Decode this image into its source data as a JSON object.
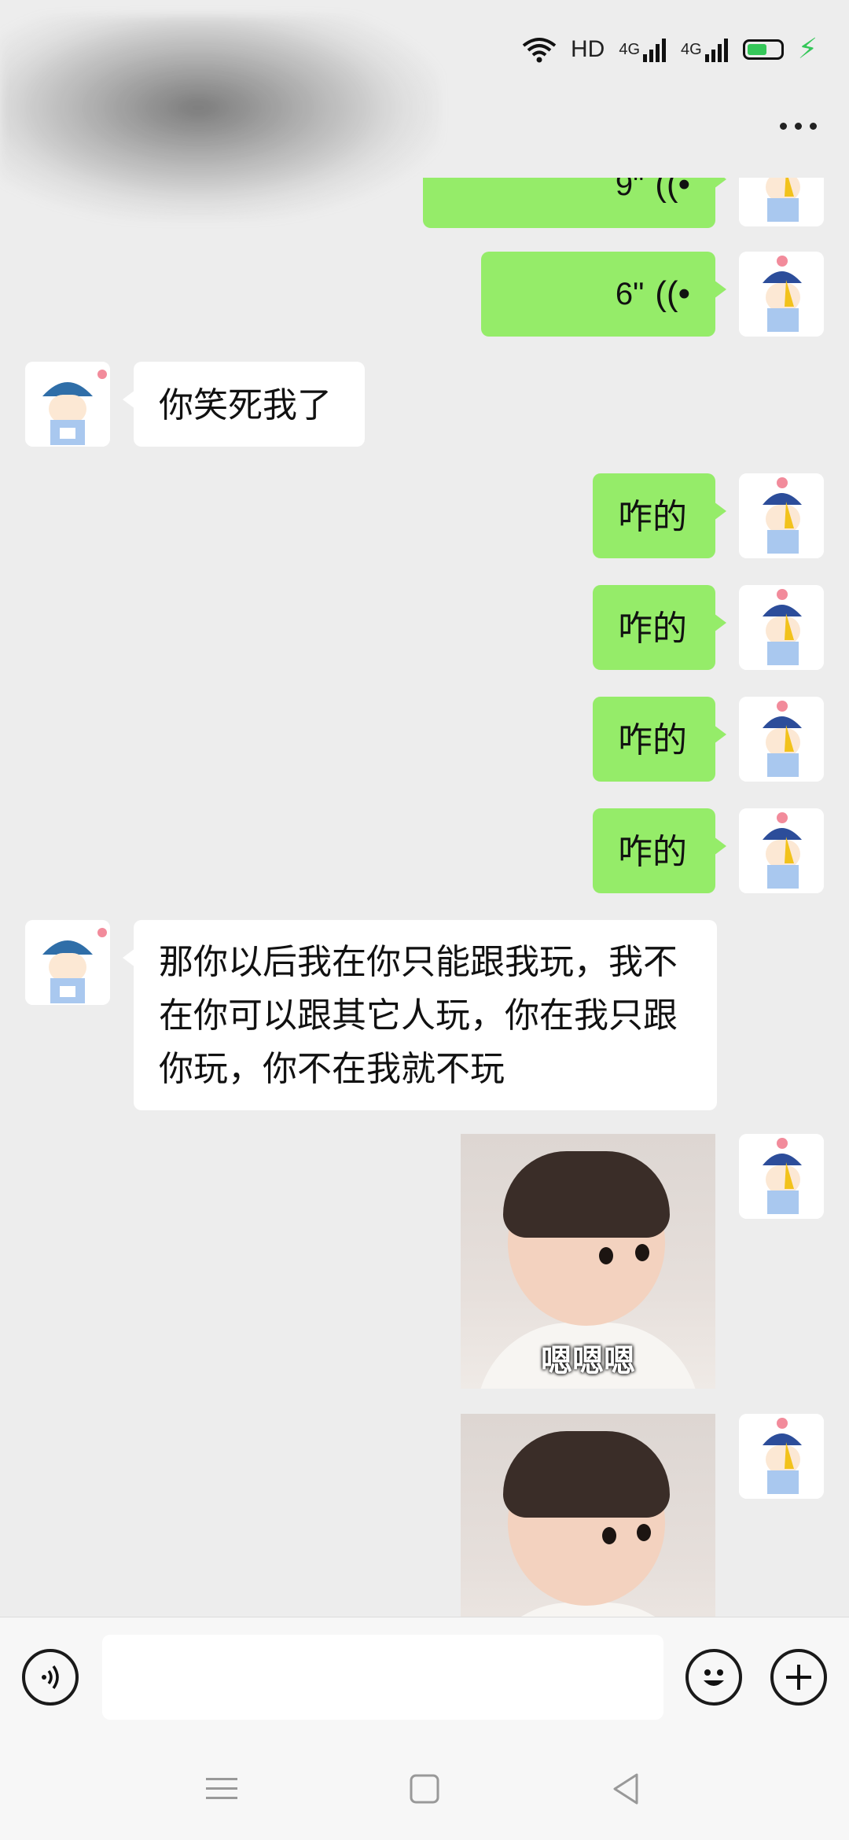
{
  "status_bar": {
    "network_label": "HD",
    "signal1_label": "4G",
    "signal2_label": "4G",
    "battery_level": 0.6,
    "charging": true
  },
  "header": {
    "more_icon": "more-horizontal-icon"
  },
  "messages": [
    {
      "side": "right",
      "type": "voice",
      "duration": "9\""
    },
    {
      "side": "right",
      "type": "voice",
      "duration": "6\""
    },
    {
      "side": "left",
      "type": "text",
      "text": "你笑死我了"
    },
    {
      "side": "right",
      "type": "text",
      "text": "咋的"
    },
    {
      "side": "right",
      "type": "text",
      "text": "咋的"
    },
    {
      "side": "right",
      "type": "text",
      "text": "咋的"
    },
    {
      "side": "right",
      "type": "text",
      "text": "咋的"
    },
    {
      "side": "left",
      "type": "text",
      "text": "那你以后我在你只能跟我玩，我不在你可以跟其它人玩，你在我只跟你玩，你不在我就不玩"
    },
    {
      "side": "right",
      "type": "sticker",
      "caption": "嗯嗯嗯"
    },
    {
      "side": "right",
      "type": "sticker",
      "caption": ""
    }
  ],
  "input_bar": {
    "voice_icon": "voice-input-icon",
    "text_value": "",
    "emoji_icon": "emoji-icon",
    "plus_icon": "plus-icon"
  },
  "nav_bar": {
    "menu_icon": "menu-icon",
    "home_icon": "home-icon",
    "back_icon": "back-icon"
  },
  "colors": {
    "background": "#ededed",
    "sent_bubble": "#95ec69",
    "received_bubble": "#ffffff",
    "battery": "#35c759"
  }
}
